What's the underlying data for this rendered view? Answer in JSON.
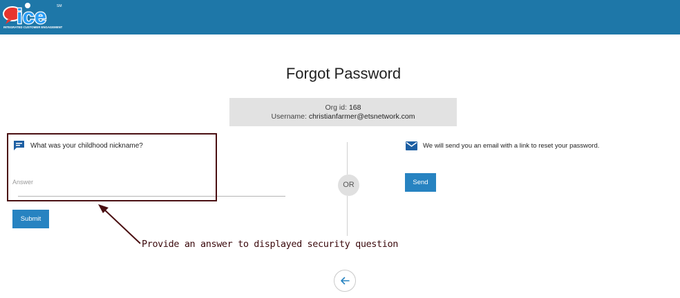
{
  "header": {
    "logo_text": "ice",
    "logo_tagline": "INTEGRATED CUSTOMER ENGAGEMENT",
    "logo_mark": "SM",
    "bar_color": "#1e77a8"
  },
  "page": {
    "title": "Forgot Password"
  },
  "info": {
    "org_label": "Org id:",
    "org_value": "168",
    "user_label": "Username:",
    "user_value": "christianfarmer@etsnetwork.com"
  },
  "security": {
    "icon": "chat-bubble-icon",
    "question": "What was your childhood nickname?",
    "answer_placeholder": "Answer",
    "submit_label": "Submit"
  },
  "divider": {
    "label": "OR"
  },
  "email": {
    "icon": "mail-icon",
    "text": "We will send you an email with a link to reset your password.",
    "send_label": "Send"
  },
  "annotation": {
    "text": "Provide an answer to displayed security question",
    "color": "#4a0f12"
  },
  "navigation": {
    "back_icon": "arrow-left-icon"
  },
  "colors": {
    "button": "#2783c1",
    "info_bg": "#e2e2e2"
  }
}
